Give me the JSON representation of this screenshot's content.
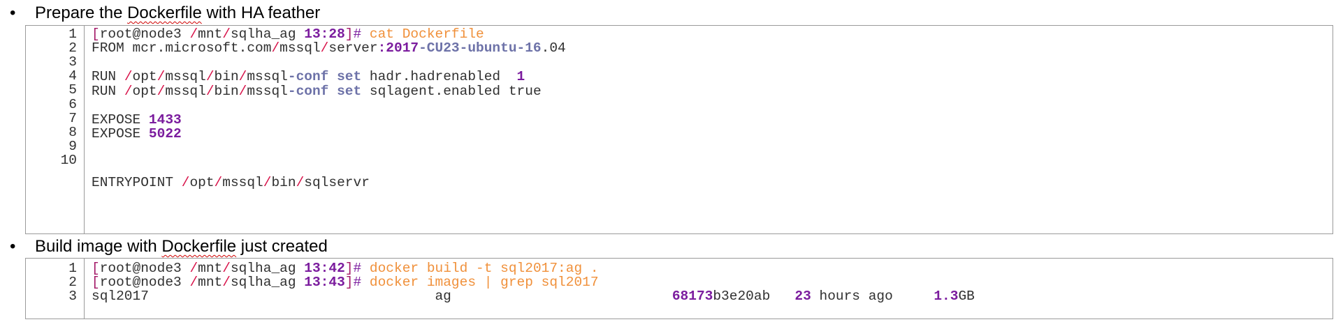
{
  "section1": {
    "bullet": "•",
    "heading_before": "Prepare the ",
    "heading_word": "Dockerfile",
    "heading_after": " with HA feather",
    "line_numbers": [
      "1",
      "2",
      "3",
      "4",
      "5",
      "6",
      "7",
      "8",
      "9",
      "10"
    ],
    "lines": [
      [
        {
          "t": "[",
          "c": "bracket"
        },
        {
          "t": "root@node3 ",
          "c": "plain"
        },
        {
          "t": "/",
          "c": "slash"
        },
        {
          "t": "mnt",
          "c": "plain"
        },
        {
          "t": "/",
          "c": "slash"
        },
        {
          "t": "sqlha_ag ",
          "c": "plain"
        },
        {
          "t": "13:28",
          "c": "time"
        },
        {
          "t": "]",
          "c": "bracket"
        },
        {
          "t": "# ",
          "c": "hash"
        },
        {
          "t": "cat Dockerfile",
          "c": "cmd"
        }
      ],
      [
        {
          "t": "FROM mcr.microsoft.com",
          "c": "plain"
        },
        {
          "t": "/",
          "c": "slash"
        },
        {
          "t": "mssql",
          "c": "plain"
        },
        {
          "t": "/",
          "c": "slash"
        },
        {
          "t": "server",
          "c": "plain"
        },
        {
          "t": ":2017",
          "c": "num"
        },
        {
          "t": "-CU23-ubuntu-16",
          "c": "kw"
        },
        {
          "t": ".04",
          "c": "plain"
        }
      ],
      [],
      [
        {
          "t": "RUN ",
          "c": "plain"
        },
        {
          "t": "/",
          "c": "slash"
        },
        {
          "t": "opt",
          "c": "plain"
        },
        {
          "t": "/",
          "c": "slash"
        },
        {
          "t": "mssql",
          "c": "plain"
        },
        {
          "t": "/",
          "c": "slash"
        },
        {
          "t": "bin",
          "c": "plain"
        },
        {
          "t": "/",
          "c": "slash"
        },
        {
          "t": "mssql",
          "c": "plain"
        },
        {
          "t": "-conf set",
          "c": "kw"
        },
        {
          "t": " hadr.hadrenabled  ",
          "c": "plain"
        },
        {
          "t": "1",
          "c": "num"
        }
      ],
      [
        {
          "t": "RUN ",
          "c": "plain"
        },
        {
          "t": "/",
          "c": "slash"
        },
        {
          "t": "opt",
          "c": "plain"
        },
        {
          "t": "/",
          "c": "slash"
        },
        {
          "t": "mssql",
          "c": "plain"
        },
        {
          "t": "/",
          "c": "slash"
        },
        {
          "t": "bin",
          "c": "plain"
        },
        {
          "t": "/",
          "c": "slash"
        },
        {
          "t": "mssql",
          "c": "plain"
        },
        {
          "t": "-conf set",
          "c": "kw"
        },
        {
          "t": " sqlagent.enabled true",
          "c": "plain"
        }
      ],
      [],
      [
        {
          "t": "EXPOSE ",
          "c": "plain"
        },
        {
          "t": "1433",
          "c": "num"
        }
      ],
      [
        {
          "t": "EXPOSE ",
          "c": "plain"
        },
        {
          "t": "5022",
          "c": "num"
        }
      ],
      [],
      [
        {
          "t": "ENTRYPOINT ",
          "c": "plain"
        },
        {
          "t": "/",
          "c": "slash"
        },
        {
          "t": "opt",
          "c": "plain"
        },
        {
          "t": "/",
          "c": "slash"
        },
        {
          "t": "mssql",
          "c": "plain"
        },
        {
          "t": "/",
          "c": "slash"
        },
        {
          "t": "bin",
          "c": "plain"
        },
        {
          "t": "/",
          "c": "slash"
        },
        {
          "t": "sqlservr",
          "c": "plain"
        }
      ]
    ]
  },
  "section2": {
    "bullet": "•",
    "heading_before": "Build image with ",
    "heading_word": "Dockerfile",
    "heading_after": " just created",
    "line_numbers": [
      "1",
      "2",
      "3"
    ],
    "lines": [
      [
        {
          "t": "[",
          "c": "bracket"
        },
        {
          "t": "root@node3 ",
          "c": "plain"
        },
        {
          "t": "/",
          "c": "slash"
        },
        {
          "t": "mnt",
          "c": "plain"
        },
        {
          "t": "/",
          "c": "slash"
        },
        {
          "t": "sqlha_ag ",
          "c": "plain"
        },
        {
          "t": "13:42",
          "c": "time"
        },
        {
          "t": "]",
          "c": "bracket"
        },
        {
          "t": "# ",
          "c": "hash"
        },
        {
          "t": "docker build -t sql2017:ag .",
          "c": "cmd"
        }
      ],
      [
        {
          "t": "[",
          "c": "bracket"
        },
        {
          "t": "root@node3 ",
          "c": "plain"
        },
        {
          "t": "/",
          "c": "slash"
        },
        {
          "t": "mnt",
          "c": "plain"
        },
        {
          "t": "/",
          "c": "slash"
        },
        {
          "t": "sqlha_ag ",
          "c": "plain"
        },
        {
          "t": "13:43",
          "c": "time"
        },
        {
          "t": "]",
          "c": "bracket"
        },
        {
          "t": "# ",
          "c": "hash"
        },
        {
          "t": "docker images | grep sql2017",
          "c": "cmd"
        }
      ],
      [
        {
          "t": "sql2017                                   ag                           ",
          "c": "plain"
        },
        {
          "t": "68173",
          "c": "num"
        },
        {
          "t": "b3e20ab   ",
          "c": "plain"
        },
        {
          "t": "23",
          "c": "num"
        },
        {
          "t": " hours ago     ",
          "c": "plain"
        },
        {
          "t": "1.3",
          "c": "num"
        },
        {
          "t": "GB",
          "c": "plain"
        }
      ]
    ]
  }
}
